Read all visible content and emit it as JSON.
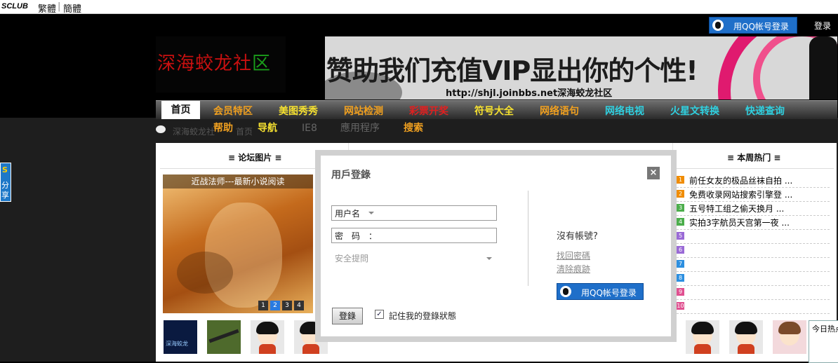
{
  "topbar": {
    "brand": "SCLUB",
    "lang_traditional": "繁體",
    "lang_separator": "|",
    "lang_simplified": "簡體"
  },
  "header": {
    "qq_login": "用QQ帐号登录",
    "login": "登录",
    "logo_text_red": "深海蛟龙社",
    "logo_text_green": "区",
    "banner_text": "赞助我们充值VIP显出你的个性!",
    "banner_url": "http://shjl.joinbbs.net深海蛟龙社区"
  },
  "nav": {
    "primary": [
      {
        "label": "首页",
        "color": "#111111"
      },
      {
        "label": "会员特区",
        "color": "#f0a020"
      },
      {
        "label": "美图秀秀",
        "color": "#f5e030"
      },
      {
        "label": "网站检测",
        "color": "#f0a020"
      },
      {
        "label": "彩票开奖",
        "color": "#e02020"
      },
      {
        "label": "符号大全",
        "color": "#f5e030"
      },
      {
        "label": "网络语句",
        "color": "#f0a020"
      },
      {
        "label": "网络电视",
        "color": "#30d0e0"
      },
      {
        "label": "火星文转换",
        "color": "#30d0e0"
      },
      {
        "label": "快递查询",
        "color": "#30d0e0"
      }
    ],
    "secondary": [
      {
        "label": "帮助",
        "color": "#f0a020"
      },
      {
        "label": "导航",
        "color": "#f5e030"
      },
      {
        "label": "IE8",
        "color": "#666666"
      },
      {
        "label": "應用程序",
        "color": "#666666"
      },
      {
        "label": "搜索",
        "color": "#f0a020"
      }
    ],
    "breadcrumb_site": "深海蛟龙社",
    "breadcrumb_home": "首页"
  },
  "side": {
    "share_s": "S",
    "share_label_1": "分",
    "share_label_2": "享"
  },
  "forum": {
    "col_pictures": "≡ 论坛图片 ≡",
    "col_hot": "≡ 本周热门 ≡",
    "slide_caption": "近战法师---最新小说阅读",
    "slide_numbers": [
      "1",
      "2",
      "3",
      "4"
    ],
    "hot_items": [
      {
        "num": "1",
        "title": "前任女友的极品丝袜自拍 ...",
        "color": "#f08c00"
      },
      {
        "num": "2",
        "title": "免费收录网站搜索引擎登 ...",
        "color": "#f08c00"
      },
      {
        "num": "3",
        "title": "五号特工组之偷天换月 ...",
        "color": "#4cae4c"
      },
      {
        "num": "4",
        "title": "实拍3字航员天宫第一夜 ...",
        "color": "#4cae4c"
      },
      {
        "num": "5",
        "title": "",
        "color": "#9a6ad6"
      },
      {
        "num": "6",
        "title": "",
        "color": "#9a6ad6"
      },
      {
        "num": "7",
        "title": "",
        "color": "#2c8fe0"
      },
      {
        "num": "8",
        "title": "",
        "color": "#2c8fe0"
      },
      {
        "num": "9",
        "title": "",
        "color": "#e05090"
      },
      {
        "num": "10",
        "title": "",
        "color": "#e05090"
      }
    ],
    "first_avatar_text": "深海蛟龙"
  },
  "login_modal": {
    "title": "用戶登錄",
    "close": "×",
    "username_label": "用户名",
    "password_label": "密　码　：",
    "security_question": "安全提問",
    "no_account": "沒有帳號?",
    "forgot_password": "找回密碼",
    "clear_traces": "清除痕跡",
    "qq_login": "用QQ帐号登录",
    "login_button": "登錄",
    "remember_me": "記住我的登錄狀態",
    "remember_checked": "✓"
  },
  "today_hot": "今日热点"
}
